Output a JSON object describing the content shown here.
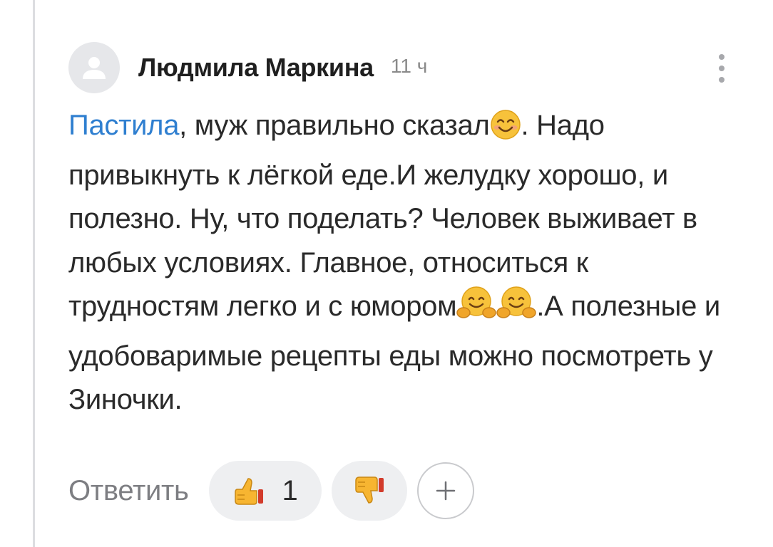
{
  "comment": {
    "author": "Людмила Маркина",
    "time": "11 ч",
    "mention": "Пастила",
    "text_part1": ", муж правильно сказал",
    "text_part2": ". Надо привыкнуть к лёгкой еде.И желудку хорошо, и полезно. Ну, что поделать? Человек выживает в любых условиях. Главное, относиться к трудностям легко и с юмором",
    "text_part3": ".А полезные и удобоваримые рецепты еды можно посмотреть у Зиночки.",
    "emojis": [
      "smiling-face-emoji",
      "hugging-face-emoji",
      "hugging-face-emoji"
    ]
  },
  "actions": {
    "reply_label": "Ответить",
    "like_count": "1",
    "like_icon": "thumbs-up-icon",
    "dislike_icon": "thumbs-down-icon",
    "add_icon": "plus-icon"
  },
  "colors": {
    "mention": "#2f7fd0",
    "text": "#2a2a2a",
    "muted": "#8a8a8a",
    "pill_bg": "#eeeff1",
    "thread_line": "#dcdde0"
  }
}
